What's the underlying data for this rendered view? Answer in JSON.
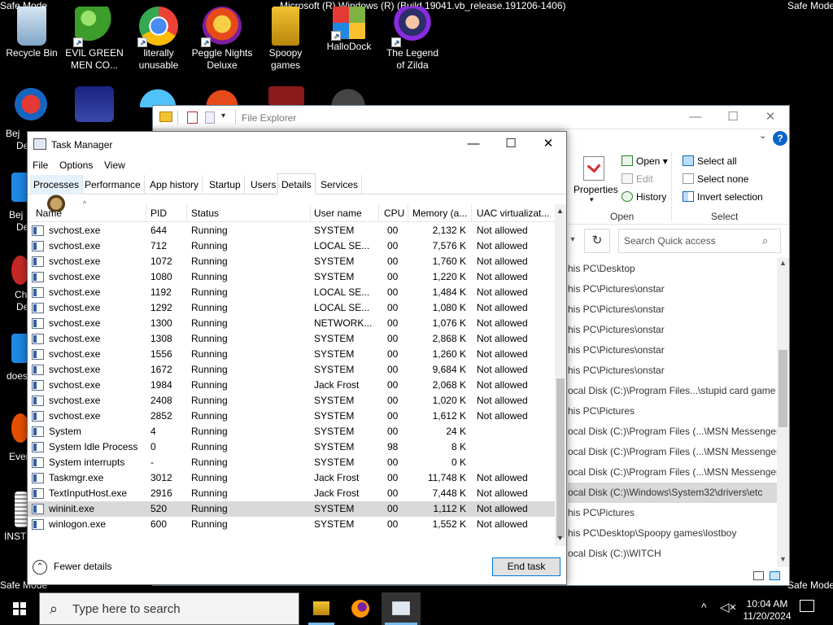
{
  "desktop": {
    "watermark_top_left": "Safe Mode",
    "watermark_top_center": "Microsoft (R) Windows (R) (Build 19041.vb_release.191206-1406)",
    "watermark_top_right": "Safe Mode",
    "watermark_bottom_left": "Safe Mode",
    "watermark_bottom_right": "Safe Mode",
    "icons": [
      {
        "label": "Recycle Bin",
        "icon": "recycle-bin-icon"
      },
      {
        "label": "EVIL GREEN MEN CO...",
        "icon": "green-men-icon"
      },
      {
        "label": "literally unusable",
        "icon": "chrome-icon"
      },
      {
        "label": "Peggle Nights Deluxe",
        "icon": "peggle-icon"
      },
      {
        "label": "Spoopy games",
        "icon": "folder-icon"
      },
      {
        "label": "HalloDock",
        "icon": "windows-logo-icon"
      },
      {
        "label": "The Legend of Zilda",
        "icon": "zilda-icon"
      }
    ],
    "left_edge_labels": [
      "Bej",
      "De",
      "Bej",
      "De",
      "Ch",
      "De",
      "does",
      "Ever",
      "INST"
    ]
  },
  "file_explorer": {
    "title": "File Explorer",
    "ribbon": {
      "properties_label": "Properties",
      "open_label": "Open",
      "edit_label": "Edit",
      "history_label": "History",
      "select_all_label": "Select all",
      "select_none_label": "Select none",
      "invert_selection_label": "Invert selection",
      "group_open": "Open",
      "group_select": "Select"
    },
    "search_placeholder": "Search Quick access",
    "paths": [
      "his PC\\Desktop",
      "his PC\\Pictures\\onstar",
      "his PC\\Pictures\\onstar",
      "his PC\\Pictures\\onstar",
      "his PC\\Pictures\\onstar",
      "his PC\\Pictures\\onstar",
      "ocal Disk (C:)\\Program Files...\\stupid card game",
      "his PC\\Pictures",
      "ocal Disk (C:)\\Program Files (...\\MSN Messenger",
      "ocal Disk (C:)\\Program Files (...\\MSN Messenger",
      "ocal Disk (C:)\\Program Files (...\\MSN Messenger",
      "ocal Disk (C:)\\Windows\\System32\\drivers\\etc",
      "his PC\\Pictures",
      "his PC\\Desktop\\Spoopy games\\lostboy",
      "ocal Disk (C:)\\WITCH"
    ]
  },
  "task_manager": {
    "title": "Task Manager",
    "menu": [
      "File",
      "Options",
      "View"
    ],
    "tabs": [
      "Processes",
      "Performance",
      "App history",
      "Startup",
      "Users",
      "Details",
      "Services"
    ],
    "active_tab": "Details",
    "columns": [
      "Name",
      "PID",
      "Status",
      "User name",
      "CPU",
      "Memory (a...",
      "UAC virtualizat..."
    ],
    "rows": [
      {
        "name": "svchost.exe",
        "pid": "644",
        "status": "Running",
        "user": "SYSTEM",
        "cpu": "00",
        "mem": "2,132 K",
        "uac": "Not allowed"
      },
      {
        "name": "svchost.exe",
        "pid": "712",
        "status": "Running",
        "user": "LOCAL SE...",
        "cpu": "00",
        "mem": "7,576 K",
        "uac": "Not allowed"
      },
      {
        "name": "svchost.exe",
        "pid": "1072",
        "status": "Running",
        "user": "SYSTEM",
        "cpu": "00",
        "mem": "1,760 K",
        "uac": "Not allowed"
      },
      {
        "name": "svchost.exe",
        "pid": "1080",
        "status": "Running",
        "user": "SYSTEM",
        "cpu": "00",
        "mem": "1,220 K",
        "uac": "Not allowed"
      },
      {
        "name": "svchost.exe",
        "pid": "1192",
        "status": "Running",
        "user": "LOCAL SE...",
        "cpu": "00",
        "mem": "1,484 K",
        "uac": "Not allowed"
      },
      {
        "name": "svchost.exe",
        "pid": "1292",
        "status": "Running",
        "user": "LOCAL SE...",
        "cpu": "00",
        "mem": "1,080 K",
        "uac": "Not allowed"
      },
      {
        "name": "svchost.exe",
        "pid": "1300",
        "status": "Running",
        "user": "NETWORK...",
        "cpu": "00",
        "mem": "1,076 K",
        "uac": "Not allowed"
      },
      {
        "name": "svchost.exe",
        "pid": "1308",
        "status": "Running",
        "user": "SYSTEM",
        "cpu": "00",
        "mem": "2,868 K",
        "uac": "Not allowed"
      },
      {
        "name": "svchost.exe",
        "pid": "1556",
        "status": "Running",
        "user": "SYSTEM",
        "cpu": "00",
        "mem": "1,260 K",
        "uac": "Not allowed"
      },
      {
        "name": "svchost.exe",
        "pid": "1672",
        "status": "Running",
        "user": "SYSTEM",
        "cpu": "00",
        "mem": "9,684 K",
        "uac": "Not allowed"
      },
      {
        "name": "svchost.exe",
        "pid": "1984",
        "status": "Running",
        "user": "Jack Frost",
        "cpu": "00",
        "mem": "2,068 K",
        "uac": "Not allowed"
      },
      {
        "name": "svchost.exe",
        "pid": "2408",
        "status": "Running",
        "user": "SYSTEM",
        "cpu": "00",
        "mem": "1,020 K",
        "uac": "Not allowed"
      },
      {
        "name": "svchost.exe",
        "pid": "2852",
        "status": "Running",
        "user": "SYSTEM",
        "cpu": "00",
        "mem": "1,612 K",
        "uac": "Not allowed"
      },
      {
        "name": "System",
        "pid": "4",
        "status": "Running",
        "user": "SYSTEM",
        "cpu": "00",
        "mem": "24 K",
        "uac": ""
      },
      {
        "name": "System Idle Process",
        "pid": "0",
        "status": "Running",
        "user": "SYSTEM",
        "cpu": "98",
        "mem": "8 K",
        "uac": ""
      },
      {
        "name": "System interrupts",
        "pid": "-",
        "status": "Running",
        "user": "SYSTEM",
        "cpu": "00",
        "mem": "0 K",
        "uac": ""
      },
      {
        "name": "Taskmgr.exe",
        "pid": "3012",
        "status": "Running",
        "user": "Jack Frost",
        "cpu": "00",
        "mem": "11,748 K",
        "uac": "Not allowed"
      },
      {
        "name": "TextInputHost.exe",
        "pid": "2916",
        "status": "Running",
        "user": "Jack Frost",
        "cpu": "00",
        "mem": "7,448 K",
        "uac": "Not allowed"
      },
      {
        "name": "wininit.exe",
        "pid": "520",
        "status": "Running",
        "user": "SYSTEM",
        "cpu": "00",
        "mem": "1,112 K",
        "uac": "Not allowed"
      },
      {
        "name": "winlogon.exe",
        "pid": "600",
        "status": "Running",
        "user": "SYSTEM",
        "cpu": "00",
        "mem": "1,552 K",
        "uac": "Not allowed"
      }
    ],
    "selected_row": "wininit.exe",
    "fewer_details_label": "Fewer details",
    "end_task_label": "End task"
  },
  "taskbar": {
    "search_placeholder": "Type here to search",
    "time": "10:04 AM",
    "date": "11/20/2024",
    "apps": [
      "file-explorer-icon",
      "firefox-icon",
      "task-manager-icon"
    ]
  },
  "colors": {
    "accent": "#0078d7",
    "selected_row": "#d9d9d9",
    "desktop_bg": "#000000"
  }
}
